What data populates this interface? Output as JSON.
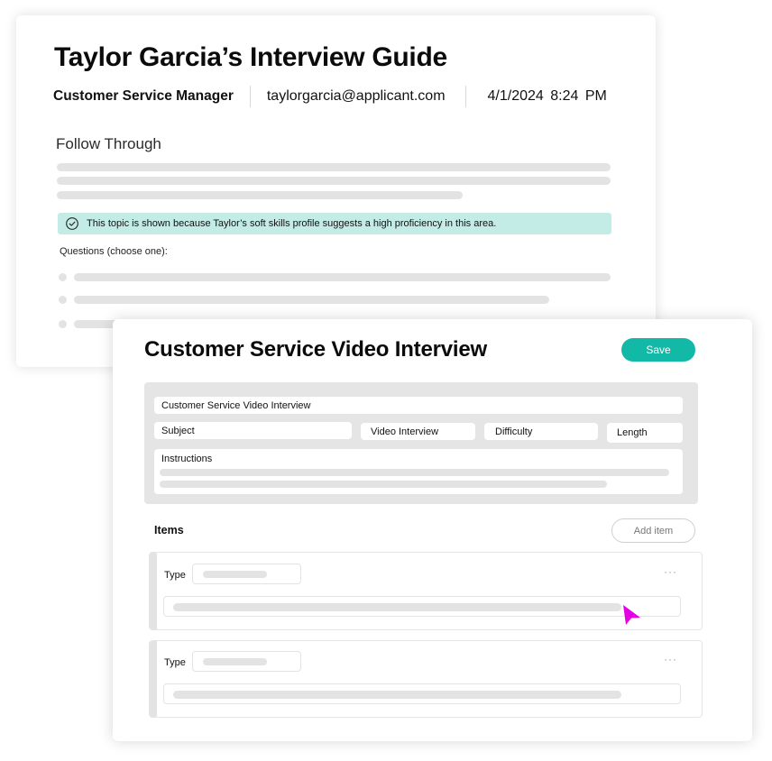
{
  "guide": {
    "title": "Taylor Garcia’s Interview Guide",
    "role": "Customer Service Manager",
    "email": "taylorgarcia@applicant.com",
    "datetime": "4/1/2024  8:24 PM",
    "section_title": "Follow Through",
    "banner": {
      "icon": "check-circle-icon",
      "text": "This topic is shown because Taylor’s soft skills profile suggests a high proficiency in this area.",
      "color": "#c4ece6"
    },
    "questions_label": "Questions (choose one):"
  },
  "video_interview": {
    "title": "Customer Service Video Interview",
    "save_label": "Save",
    "accent_color": "#12b9a6",
    "form": {
      "name_value": "Customer Service Video Interview",
      "subject_placeholder": "Subject",
      "type_value": "Video Interview",
      "difficulty_placeholder": "Difficulty",
      "length_placeholder": "Length",
      "instructions_label": "Instructions"
    },
    "items_label": "Items",
    "add_item_label": "Add item",
    "items": [
      {
        "type_label": "Type",
        "more_icon": "more-horizontal-icon",
        "more_glyph": "···"
      },
      {
        "type_label": "Type",
        "more_icon": "more-horizontal-icon",
        "more_glyph": "···"
      }
    ],
    "cursor_color": "#e600e6"
  }
}
